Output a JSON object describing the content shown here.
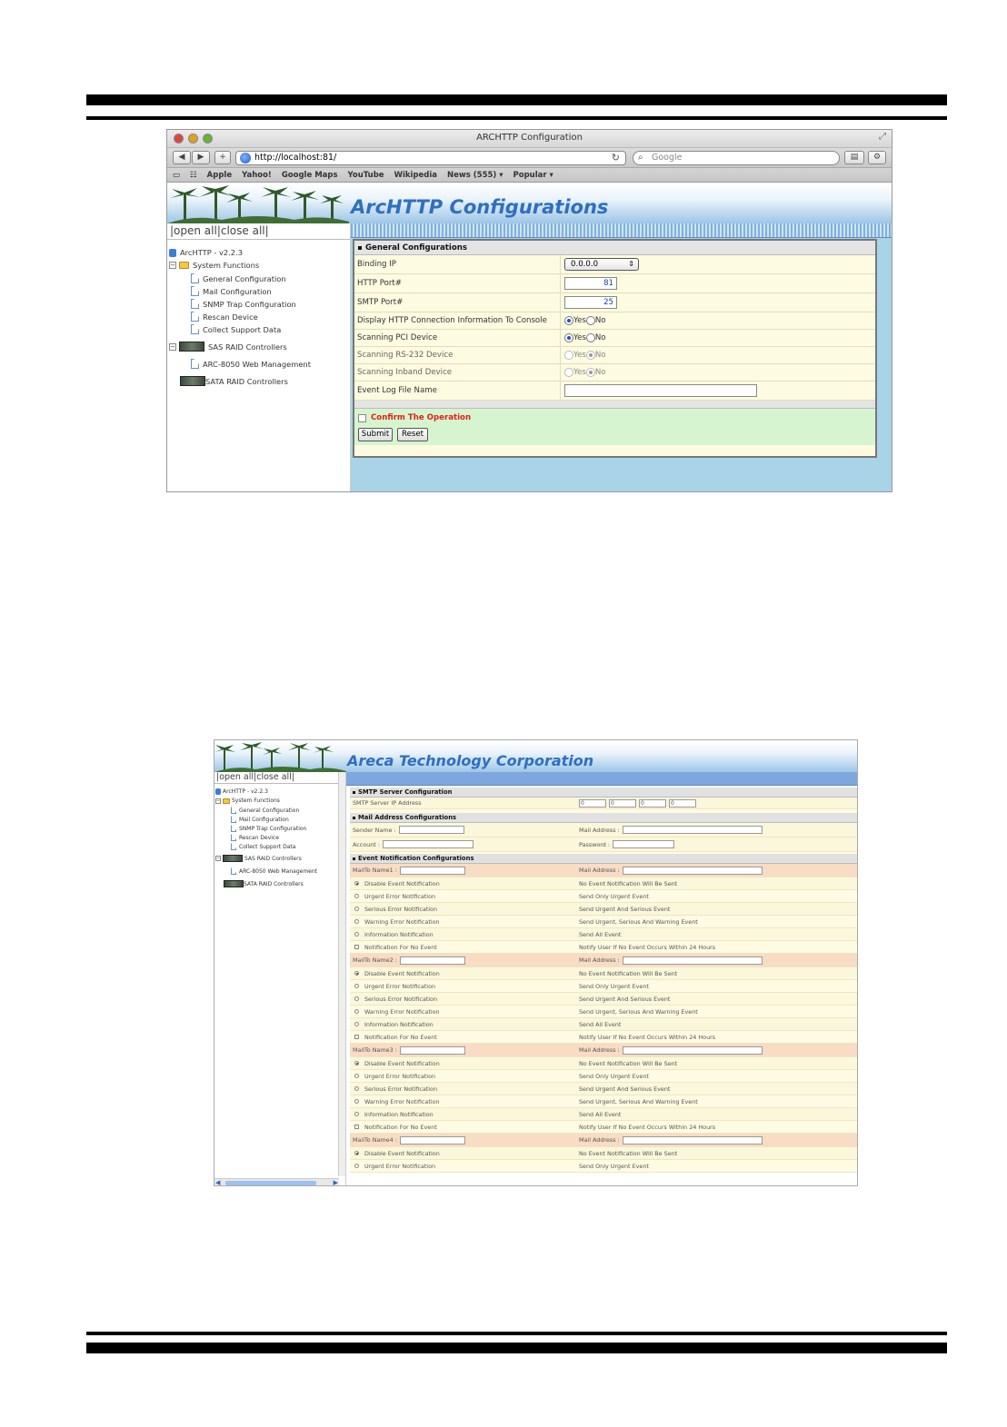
{
  "window": {
    "title": "ARCHTTP Configuration",
    "url": "http://localhost:81/",
    "search_placeholder": "Google",
    "bookmarks": [
      "Apple",
      "Yahoo!",
      "Google Maps",
      "YouTube",
      "Wikipedia",
      "News (555) ▾",
      "Popular ▾"
    ]
  },
  "top": {
    "brand": "ArcHTTP Configurations",
    "open_close": "|open all|close all|",
    "tree": {
      "root": "ArcHTTP - v2.2.3",
      "system_functions": "System Functions",
      "items": [
        "General Configuration",
        "Mail Configuration",
        "SNMP Trap Configuration",
        "Rescan Device",
        "Collect Support Data"
      ],
      "sas": "SAS RAID Controllers",
      "sas_item": "ARC-8050 Web Management",
      "sata": "SATA RAID Controllers"
    },
    "section_title": "General Configurations",
    "rows": {
      "binding_ip": {
        "label": "Binding IP",
        "value": "0.0.0.0"
      },
      "http_port": {
        "label": "HTTP Port#",
        "value": "81"
      },
      "smtp_port": {
        "label": "SMTP Port#",
        "value": "25"
      },
      "display_http": {
        "label": "Display HTTP Connection Information To Console",
        "selected": "Yes"
      },
      "scan_pci": {
        "label": "Scanning PCI Device",
        "selected": "Yes"
      },
      "scan_rs232": {
        "label": "Scanning RS-232 Device",
        "selected": "No"
      },
      "scan_inband": {
        "label": "Scanning Inband Device",
        "selected": "No"
      },
      "event_log": {
        "label": "Event Log File Name",
        "value": ""
      }
    },
    "yes": "Yes",
    "no": "No",
    "confirm": "Confirm The Operation",
    "submit": "Submit",
    "reset": "Reset"
  },
  "bottom": {
    "brand": "Areca Technology Corporation",
    "open_close": "|open all|close all|",
    "tree": {
      "root": "ArcHTTP - v2.2.3",
      "system_functions": "System Functions",
      "items": [
        "General Configuration",
        "Mail Configuration",
        "SNMP Trap Configuration",
        "Rescan Device",
        "Collect Support Data"
      ],
      "sas": "SAS RAID Controllers",
      "sas_item": "ARC-8050 Web Management",
      "sata": "SATA RAID Controllers"
    },
    "smtp_section": "SMTP Server Configuration",
    "smtp_ip_label": "SMTP Server IP Address",
    "smtp_ip": [
      "0",
      "0",
      "0",
      "0"
    ],
    "mail_section": "Mail Address Configurations",
    "sender_name": "Sender Name :",
    "mail_address": "Mail Address :",
    "account": "Account :",
    "password": "Password :",
    "event_section": "Event Notification Configurations",
    "recipients": [
      "MailTo Name1 :",
      "MailTo Name2 :",
      "MailTo Name3 :",
      "MailTo Name4 :"
    ],
    "options": [
      {
        "label": "Disable Event Notification",
        "desc": "No Event Notification Will Be Sent"
      },
      {
        "label": "Urgent Error Notification",
        "desc": "Send Only Urgent Event"
      },
      {
        "label": "Serious Error Notification",
        "desc": "Send Urgent And Serious Event"
      },
      {
        "label": "Warning Error Notification",
        "desc": "Send Urgent, Serious And Warning Event"
      },
      {
        "label": "Information Notification",
        "desc": "Send All Event"
      },
      {
        "label": "Notification For No Event",
        "desc": "Notify User If No Event Occurs Within 24 Hours"
      }
    ]
  }
}
